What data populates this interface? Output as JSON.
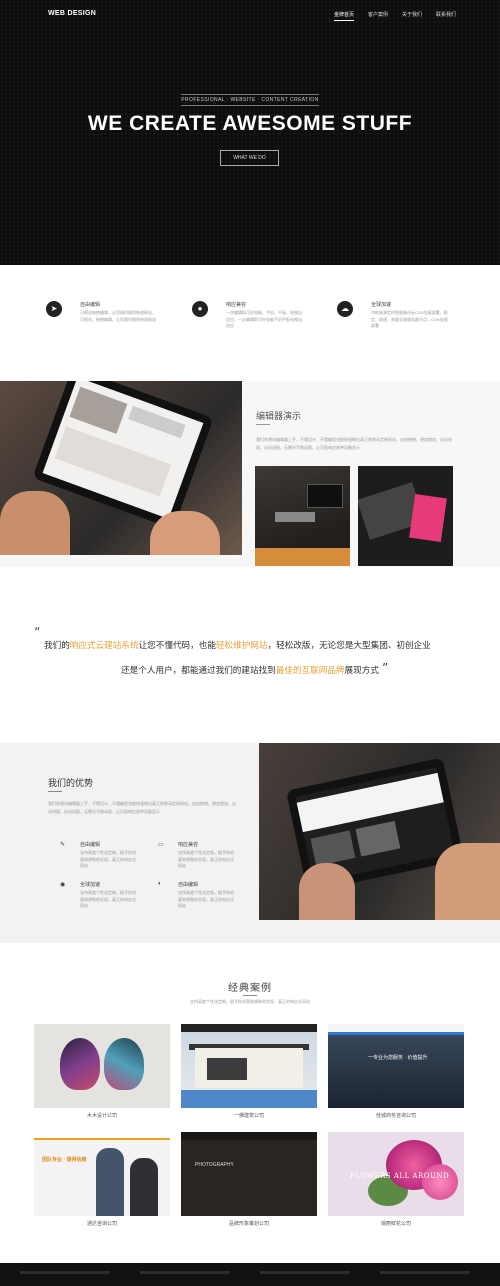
{
  "header": {
    "logo": "WEB DESIGN",
    "nav": [
      "金牌首页",
      "客户案例",
      "关于我们",
      "联系我们"
    ]
  },
  "hero": {
    "subtitle": "PROFESSIONAL · WEBSITE · CONTENT CREATION",
    "title": "WE CREATE AWESOME STUFF",
    "button": "WHAT WE DO"
  },
  "features": [
    {
      "icon": "location-icon",
      "title": "自由编辑",
      "text": "可视化拖拽编辑，让您随时随地修改网站，可视化，拖拽编辑，让您随时随地修改网站"
    },
    {
      "icon": "bulb-icon",
      "title": "响应兼容",
      "text": "一次编辑即可在电脑、手机、平板、电视自适应，一次编辑即可在电脑手机平板电视自适应"
    },
    {
      "icon": "cloud-icon",
      "title": "全球加速",
      "text": "内地来源定时智能备份云CDN加速部署，稳定、极速、海量全球服务器节点，CDN加速部署"
    }
  ],
  "demo": {
    "title": "编辑器演示",
    "text": "我们的建站编辑器上手，不懂设计、不懂编程也能快速做出真正的移动定制网站，自由拖拽、想加就加、自动排版、自动适配，无需另写移动版，让页面响应各种设备显示"
  },
  "quote": {
    "part1": "我们的",
    "hl1": "响应式云建站系统",
    "part2": "让您不懂代码，也能",
    "hl2": "轻松维护网站",
    "part3": "，轻松改版，无论您是大型集团、初创企业",
    "part4": "还是个人用户，都能通过我们的建站找到",
    "hl3": "最佳的互联网品牌",
    "part5": "展现方式"
  },
  "advantages": {
    "title": "我们的优势",
    "text": "我们的建站编辑器上手，不懂设计、不懂编程也能快速做出真正的移动定制网站，自由拖拽、想加就加、自动排版、自动适配，无需另写移动版，让页面响应各种设备显示",
    "items": [
      {
        "icon": "edit-icon",
        "title": "自由编辑",
        "text": "支持高度个性化定制，赋予你创意和想象的实现，真正的响应式网站"
      },
      {
        "icon": "monitor-icon",
        "title": "响应兼容",
        "text": "支持高度个性化定制，赋予你创意和想象的实现，真正的响应式网站"
      },
      {
        "icon": "globe-icon",
        "title": "全球加速",
        "text": "支持高度个性化定制，赋予你创意和想象的实现，真正的响应式网站"
      },
      {
        "icon": "dashboard-icon",
        "title": "自由编辑",
        "text": "支持高度个性化定制，赋予你创意和想象的实现，真正的响应式网站"
      }
    ]
  },
  "cases": {
    "title": "经典案例",
    "subtitle": "支持高度个性化定制，赋予你创意和想象的实现，真正的响应式网站",
    "items": [
      {
        "caption": "木木设计公司"
      },
      {
        "caption": "一佛建筑公司"
      },
      {
        "caption": "佳城商务咨询公司",
        "overlay": "一专业为您服务 · 价值提升"
      },
      {
        "caption": "通达咨询公司",
        "overlay": "团队专业 · 值得信赖"
      },
      {
        "caption": "品牌形象策划公司",
        "overlay": "PHOTOGRAPHY"
      },
      {
        "caption": "俏丽鲜花公司",
        "overlay": "FLOWERS ALL AROUND"
      }
    ]
  },
  "colors": {
    "accent": "#e6a23c",
    "hero_bg": "#0d0d0d"
  }
}
